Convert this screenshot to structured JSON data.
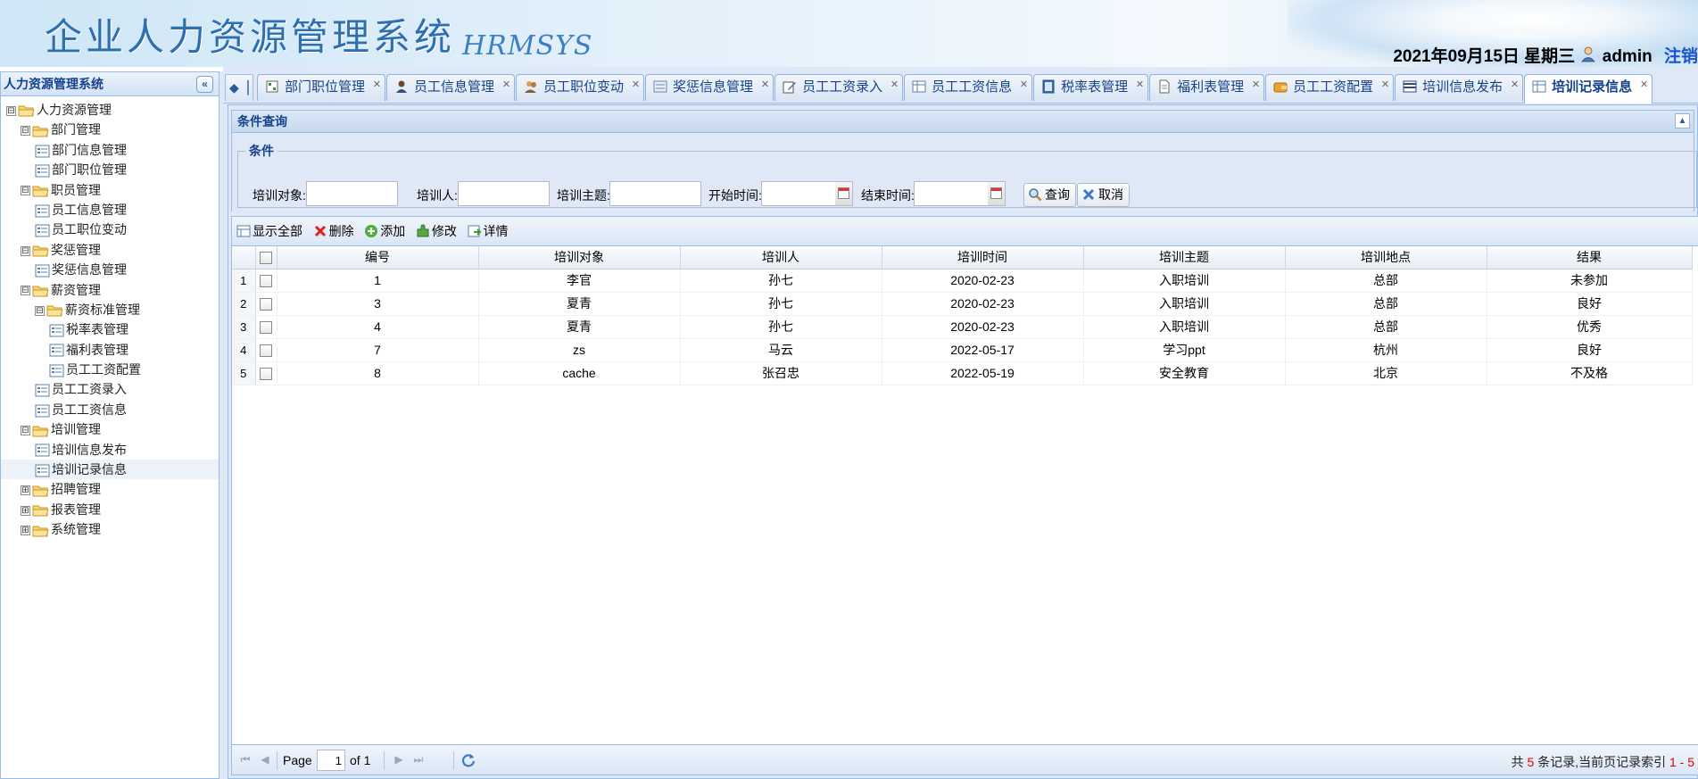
{
  "header": {
    "title": "企业人力资源管理系统",
    "subtitle": "HRMSYS",
    "date": "2021年09月15日 星期三",
    "user": "admin",
    "logout": "注销"
  },
  "sidebar": {
    "title": "人力资源管理系统",
    "collapse_icon": "«",
    "tree": [
      {
        "label": "人力资源管理",
        "type": "folder",
        "level": 0,
        "exp": "⊟"
      },
      {
        "label": "部门管理",
        "type": "folder",
        "level": 1,
        "exp": "⊟"
      },
      {
        "label": "部门信息管理",
        "type": "leaf",
        "level": 2
      },
      {
        "label": "部门职位管理",
        "type": "leaf",
        "level": 2
      },
      {
        "label": "职员管理",
        "type": "folder",
        "level": 1,
        "exp": "⊟"
      },
      {
        "label": "员工信息管理",
        "type": "leaf",
        "level": 2
      },
      {
        "label": "员工职位变动",
        "type": "leaf",
        "level": 2
      },
      {
        "label": "奖惩管理",
        "type": "folder",
        "level": 1,
        "exp": "⊟"
      },
      {
        "label": "奖惩信息管理",
        "type": "leaf",
        "level": 2
      },
      {
        "label": "薪资管理",
        "type": "folder",
        "level": 1,
        "exp": "⊟"
      },
      {
        "label": "薪资标准管理",
        "type": "folder",
        "level": 2,
        "exp": "⊟"
      },
      {
        "label": "税率表管理",
        "type": "leaf",
        "level": 3
      },
      {
        "label": "福利表管理",
        "type": "leaf",
        "level": 3
      },
      {
        "label": "员工工资配置",
        "type": "leaf",
        "level": 3
      },
      {
        "label": "员工工资录入",
        "type": "leaf",
        "level": 2
      },
      {
        "label": "员工工资信息",
        "type": "leaf",
        "level": 2
      },
      {
        "label": "培训管理",
        "type": "folder",
        "level": 1,
        "exp": "⊟"
      },
      {
        "label": "培训信息发布",
        "type": "leaf",
        "level": 2
      },
      {
        "label": "培训记录信息",
        "type": "leaf",
        "level": 2,
        "selected": true
      },
      {
        "label": "招聘管理",
        "type": "folder",
        "level": 1,
        "exp": "⊞"
      },
      {
        "label": "报表管理",
        "type": "folder",
        "level": 1,
        "exp": "⊞"
      },
      {
        "label": "系统管理",
        "type": "folder",
        "level": 1,
        "exp": "⊞"
      }
    ]
  },
  "tabs": [
    {
      "label": "部门职位管理",
      "icon": "org-chart-icon"
    },
    {
      "label": "员工信息管理",
      "icon": "user-icon"
    },
    {
      "label": "员工职位变动",
      "icon": "users-icon"
    },
    {
      "label": "奖惩信息管理",
      "icon": "list-icon"
    },
    {
      "label": "员工工资录入",
      "icon": "edit-icon"
    },
    {
      "label": "员工工资信息",
      "icon": "table-icon"
    },
    {
      "label": "税率表管理",
      "icon": "book-icon"
    },
    {
      "label": "福利表管理",
      "icon": "document-icon"
    },
    {
      "label": "员工工资配置",
      "icon": "wallet-icon"
    },
    {
      "label": "培训信息发布",
      "icon": "flag-icon"
    },
    {
      "label": "培训记录信息",
      "icon": "table-icon",
      "active": true
    }
  ],
  "query": {
    "panel_title": "条件查询",
    "legend": "条件",
    "fields": {
      "target": {
        "label": "培训对象:",
        "value": ""
      },
      "trainer": {
        "label": "培训人:",
        "value": ""
      },
      "topic": {
        "label": "培训主题:",
        "value": ""
      },
      "start": {
        "label": "开始时间:",
        "value": ""
      },
      "end": {
        "label": "结束时间:",
        "value": ""
      }
    },
    "search_button": "查询",
    "cancel_button": "取消"
  },
  "toolbar": {
    "show_all": "显示全部",
    "delete": "删除",
    "add": "添加",
    "edit": "修改",
    "detail": "详情"
  },
  "grid": {
    "columns": [
      "编号",
      "培训对象",
      "培训人",
      "培训时间",
      "培训主题",
      "培训地点",
      "结果"
    ],
    "rows": [
      {
        "rn": "1",
        "id": "1",
        "target": "李官",
        "trainer": "孙七",
        "time": "2020-02-23",
        "topic": "入职培训",
        "place": "总部",
        "result": "未参加"
      },
      {
        "rn": "2",
        "id": "3",
        "target": "夏青",
        "trainer": "孙七",
        "time": "2020-02-23",
        "topic": "入职培训",
        "place": "总部",
        "result": "良好"
      },
      {
        "rn": "3",
        "id": "4",
        "target": "夏青",
        "trainer": "孙七",
        "time": "2020-02-23",
        "topic": "入职培训",
        "place": "总部",
        "result": "优秀"
      },
      {
        "rn": "4",
        "id": "7",
        "target": "zs",
        "trainer": "马云",
        "time": "2022-05-17",
        "topic": "学习ppt",
        "place": "杭州",
        "result": "良好"
      },
      {
        "rn": "5",
        "id": "8",
        "target": "cache",
        "trainer": "张召忠",
        "time": "2022-05-19",
        "topic": "安全教育",
        "place": "北京",
        "result": "不及格"
      }
    ]
  },
  "pager": {
    "page_label": "Page",
    "page_value": "1",
    "of_label": "of 1",
    "info_prefix": "共",
    "total": "5",
    "info_mid": "条记录,当前页记录索引",
    "range": "1 - 5"
  }
}
